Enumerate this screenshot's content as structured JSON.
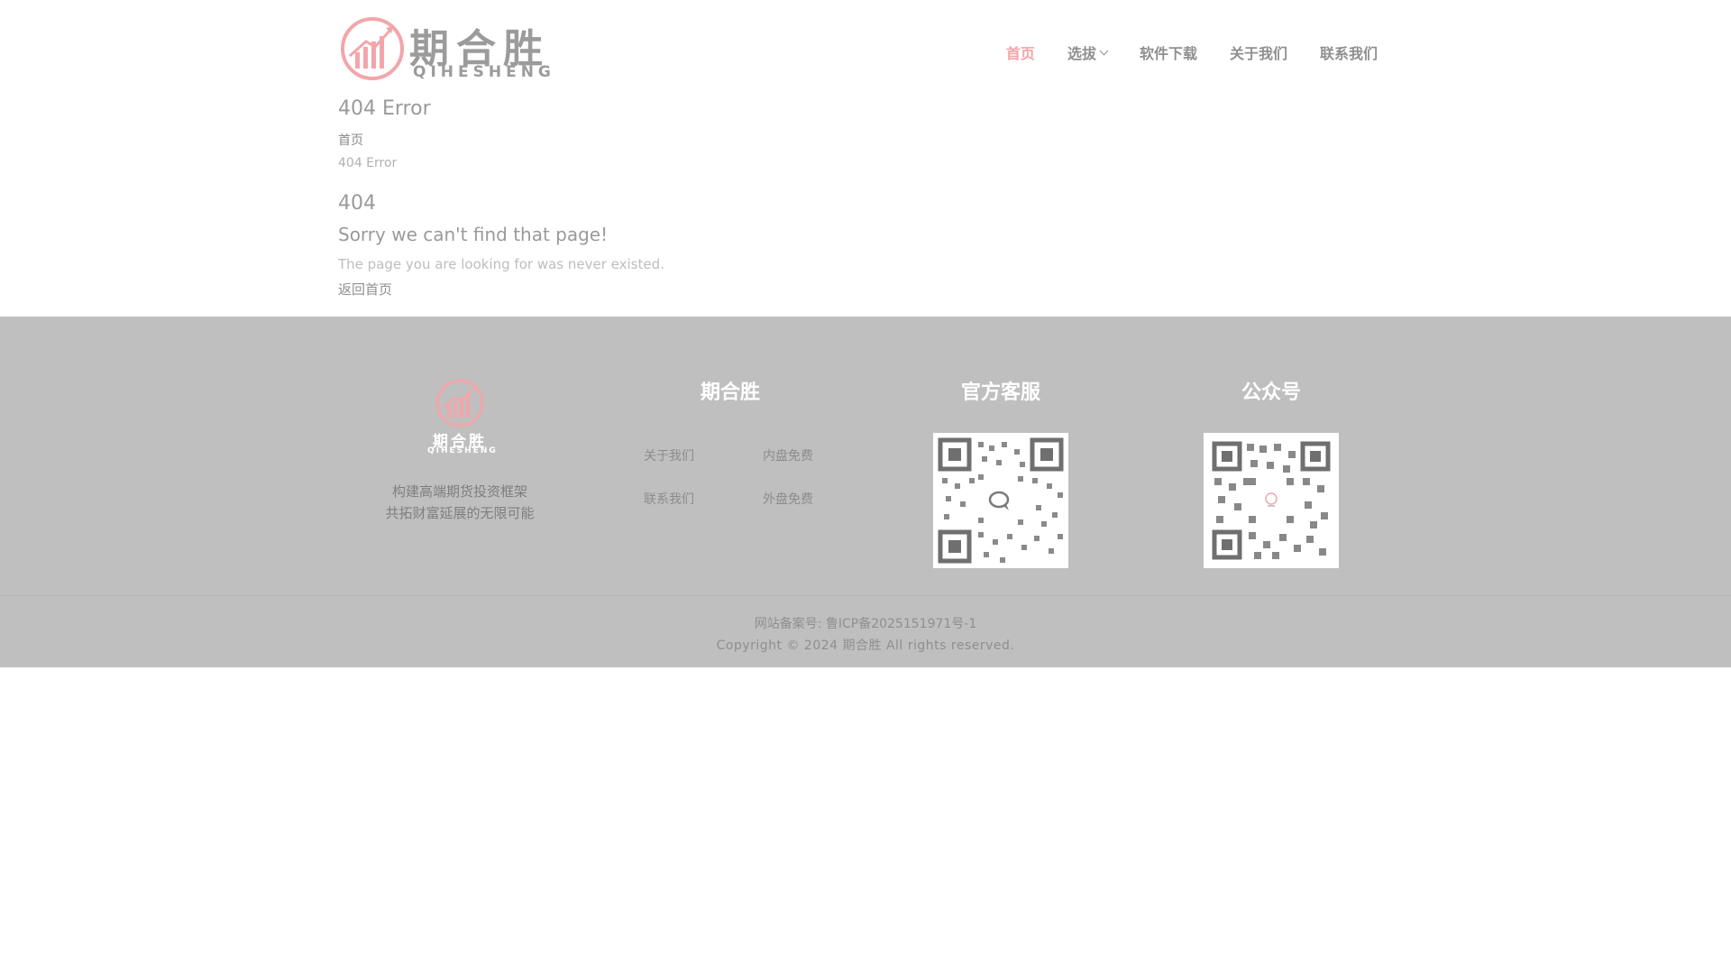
{
  "header": {
    "logo_cn": "期合胜",
    "logo_en": "QIHESHENG",
    "nav": [
      {
        "label": "首页",
        "active": true
      },
      {
        "label": "选拔",
        "has_dropdown": true
      },
      {
        "label": "软件下载"
      },
      {
        "label": "关于我们"
      },
      {
        "label": "联系我们"
      }
    ]
  },
  "page": {
    "title": "404 Error",
    "breadcrumb": {
      "home": "首页",
      "current": "404 Error"
    },
    "error_code": "404",
    "error_title": "Sorry we can't find that page!",
    "error_desc": "The page you are looking for was never existed.",
    "back_link": "返回首页"
  },
  "footer": {
    "brand": {
      "logo_cn": "期合胜",
      "logo_en": "QIHESHENG",
      "slogan_line1": "构建高端期货投资框架",
      "slogan_line2": "共拓财富延展的无限可能"
    },
    "col_brand_title": "期合胜",
    "links": [
      "关于我们",
      "内盘免费",
      "联系我们",
      "外盘免费"
    ],
    "col_service_title": "官方客服",
    "col_official_title": "公众号",
    "icp": "网站备案号: 鲁ICP备2025151971号-1",
    "copyright": "Copyright © 2024 期合胜 All rights reserved."
  },
  "colors": {
    "accent": "#f4a3a7",
    "footer_bg": "#bfbfbf",
    "nav_text": "#8f8f8f"
  },
  "icons": {
    "logo_mark": "rising-bars-chart-icon",
    "dropdown": "chevron-down-icon",
    "qr_service": "wechat-qr-code",
    "qr_official": "official-account-qr-code"
  }
}
